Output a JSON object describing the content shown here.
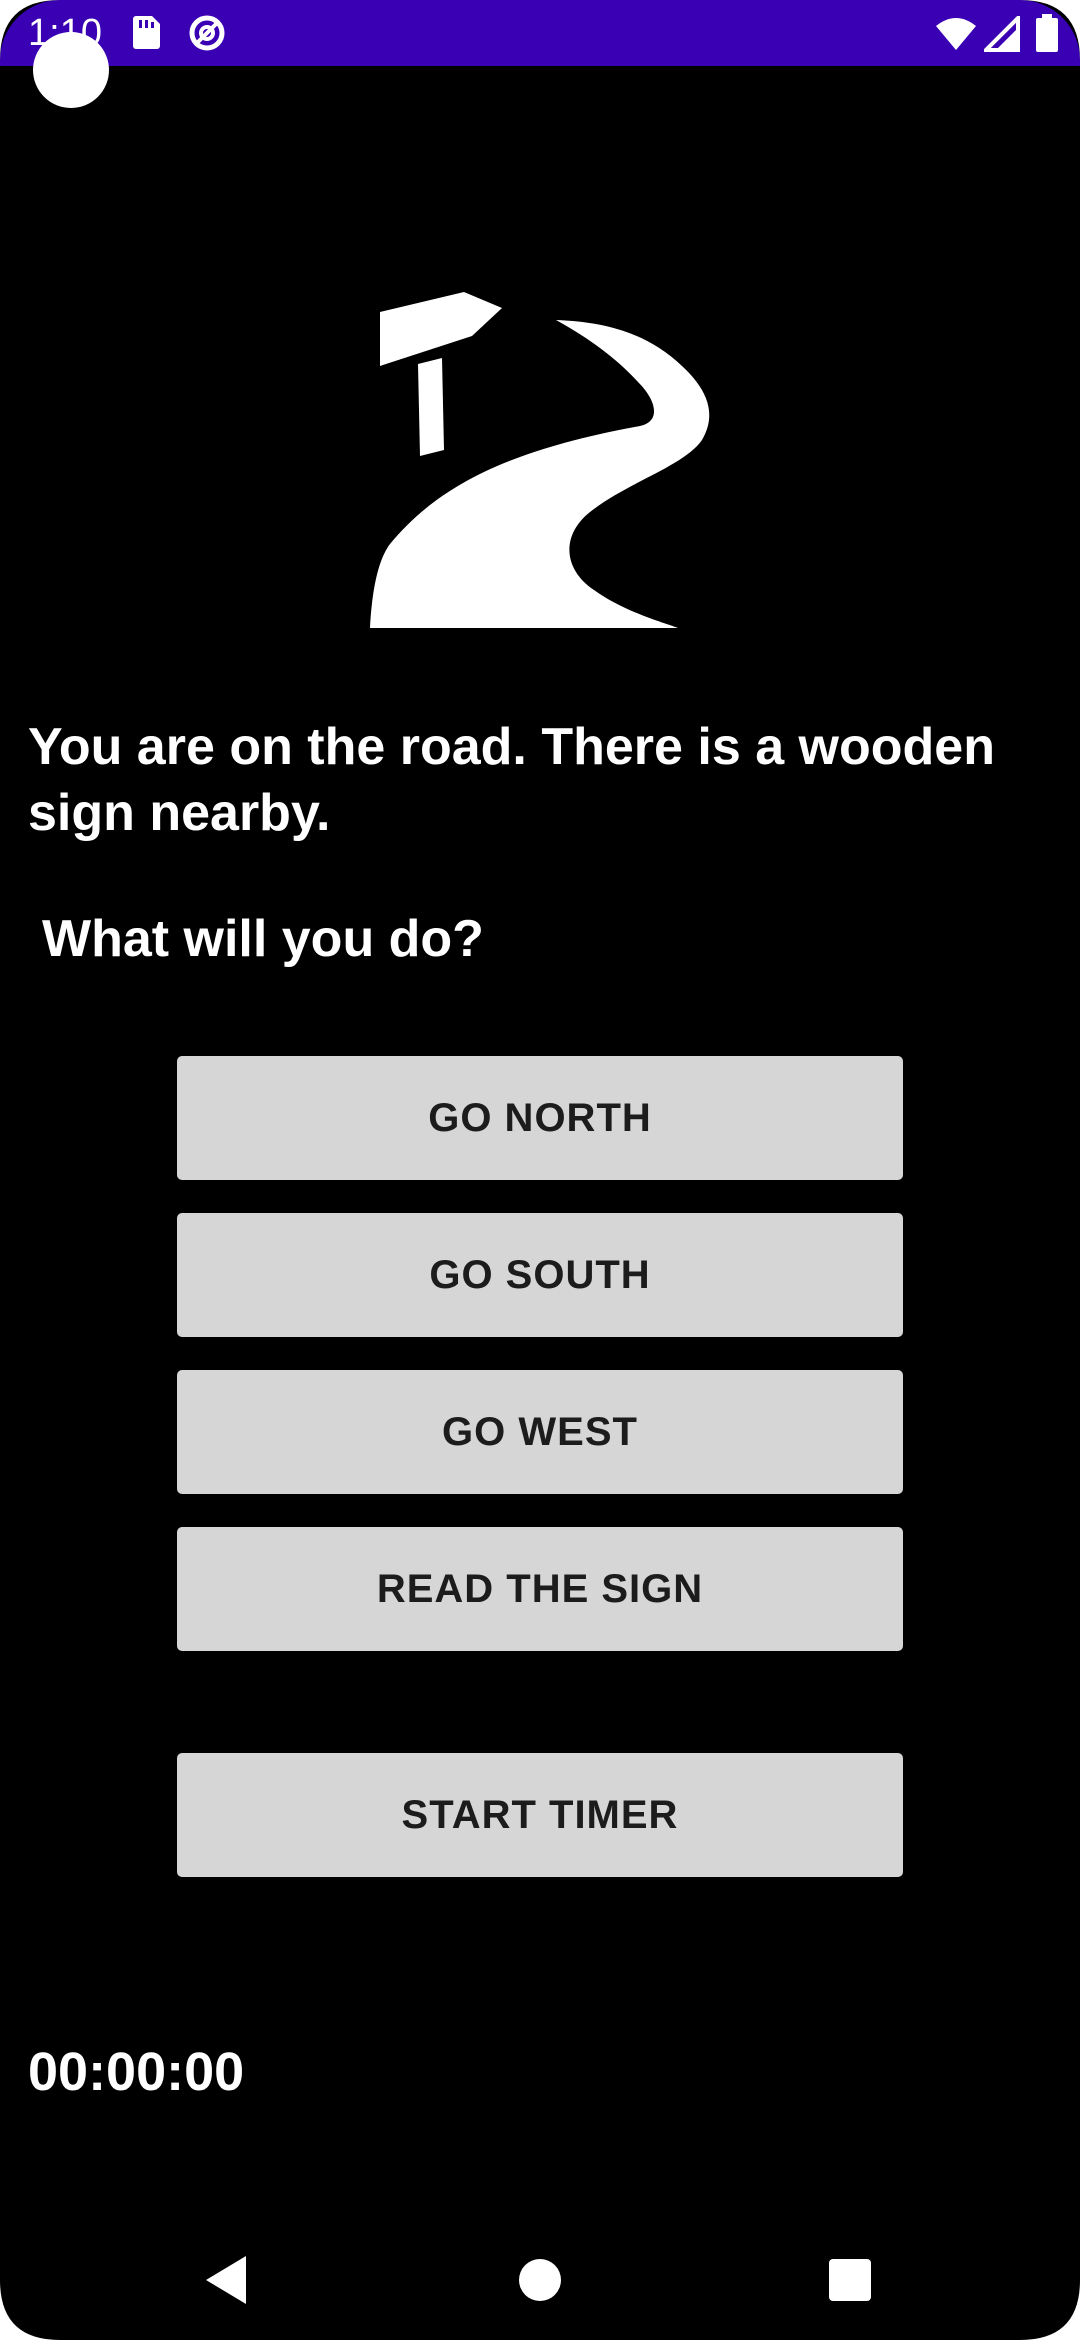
{
  "status_bar": {
    "time": "1:10",
    "color": "#3a00b4",
    "icons": [
      "sd-card-icon",
      "at-sign-icon",
      "wifi-icon",
      "signal-icon",
      "battery-icon"
    ]
  },
  "hero": {
    "icon": "road-with-signpost-icon"
  },
  "story": {
    "text": "You are on the road. There is a wooden sign nearby.",
    "prompt": "What will you do?"
  },
  "actions": {
    "go_north": "GO NORTH",
    "go_south": "GO SOUTH",
    "go_west": "GO WEST",
    "read_sign": "READ THE SIGN",
    "start_timer": "START TIMER"
  },
  "timer": {
    "value": "00:00:00"
  },
  "nav_bar": {
    "icons": [
      "back-icon",
      "home-icon",
      "recents-icon"
    ]
  }
}
